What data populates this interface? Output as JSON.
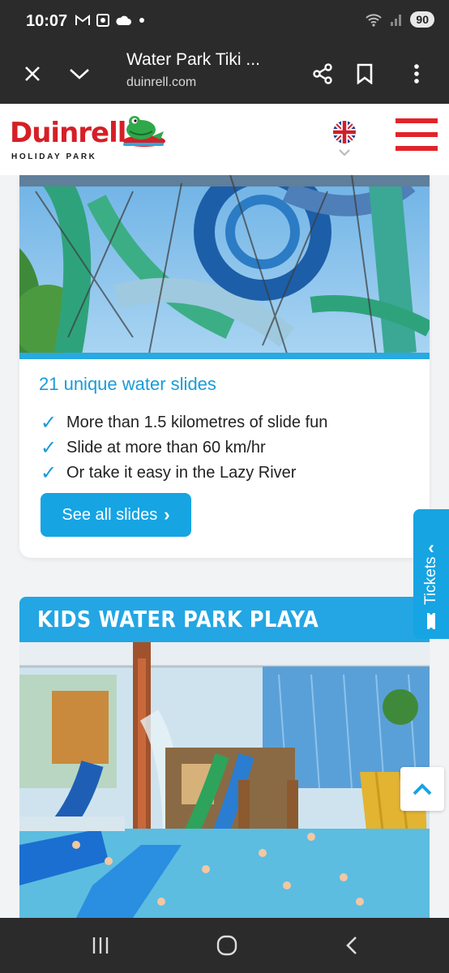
{
  "status_bar": {
    "time": "10:07",
    "battery": "90",
    "icons": [
      "gmail-icon",
      "screen-record-icon",
      "cloud-icon",
      "dot-icon",
      "wifi-5-icon",
      "signal-icon"
    ]
  },
  "browser": {
    "page_title": "Water Park Tiki ...",
    "url": "duinrell.com",
    "close_icon": "close-icon",
    "dropdown_icon": "chevron-down-icon",
    "share_icon": "share-icon",
    "bookmark_icon": "bookmark-icon",
    "menu_icon": "more-vertical-icon"
  },
  "site_header": {
    "logo_word": "Duinrell",
    "logo_sub": "HOLIDAY PARK",
    "language_icon": "uk-flag-icon",
    "menu_icon": "hamburger-icon"
  },
  "slides_card": {
    "title": "21 unique water slides",
    "bullets": [
      "More than 1.5 kilometres of slide fun",
      "Slide at more than 60 km/hr",
      "Or take it easy in the Lazy River"
    ],
    "cta_label": "See all slides",
    "cta_arrow": "›"
  },
  "kids_card": {
    "title": "KIDS WATER PARK PLAYA"
  },
  "tickets_tab": {
    "label": "Tickets",
    "arrow": "‹"
  },
  "colors": {
    "accent": "#16a4e3",
    "brand_red": "#e2232a",
    "system_bar": "#2b2b2b"
  }
}
